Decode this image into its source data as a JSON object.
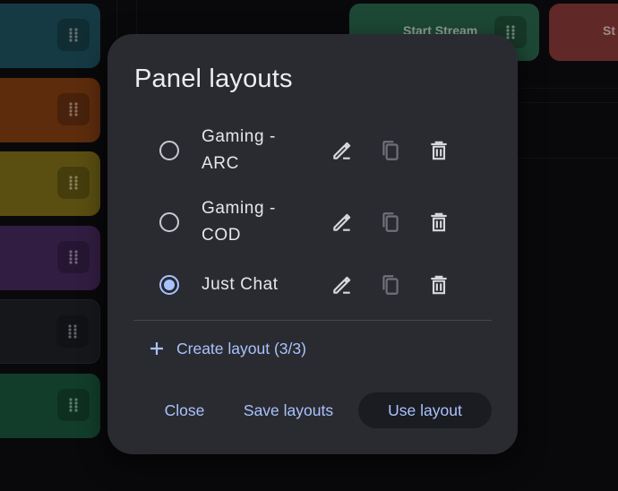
{
  "background": {
    "top_buttons": [
      {
        "label": "Start Stream",
        "color": "#2c6b4e"
      },
      {
        "label": "St",
        "color": "#8f3c3c"
      }
    ],
    "side_buttons": [
      {
        "color": "#1f5663"
      },
      {
        "color": "#8a4214"
      },
      {
        "color": "#85741a"
      },
      {
        "color": "#4a2b62"
      },
      {
        "color": "#1f2329"
      },
      {
        "color": "#1b5b3e"
      }
    ]
  },
  "dialog": {
    "title": "Panel layouts",
    "layouts": [
      {
        "name": "Gaming - ARC",
        "selected": false
      },
      {
        "name": "Gaming - COD",
        "selected": false
      },
      {
        "name": "Just Chat",
        "selected": true
      }
    ],
    "create_label": "Create layout (3/3)",
    "actions": {
      "close": "Close",
      "save": "Save layouts",
      "use": "Use layout"
    }
  },
  "colors": {
    "accent": "#a9c2ff",
    "dialog_bg": "#2a2b30",
    "page_bg": "#0e0e11"
  }
}
